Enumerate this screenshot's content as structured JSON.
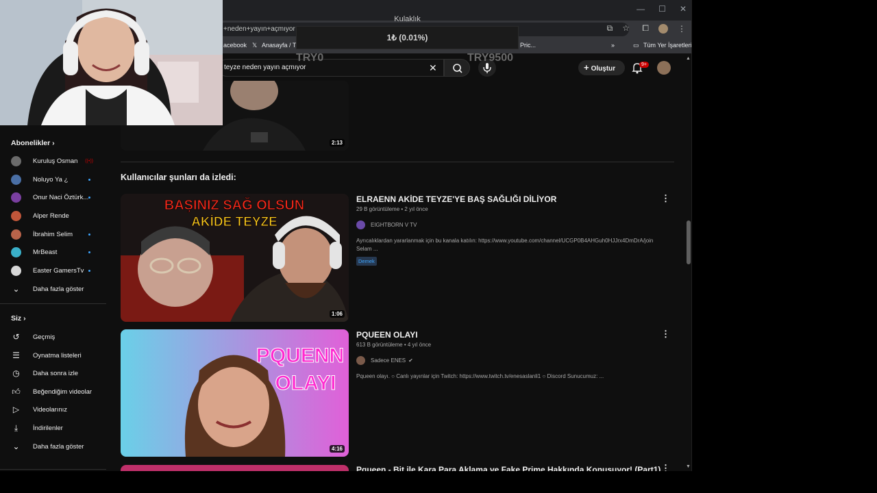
{
  "window": {
    "minimize": "—",
    "maximize": "☐",
    "close": "✕"
  },
  "address_bar": {
    "url_text": "+neden+yayın+açmıyor"
  },
  "bookmarks": {
    "items": [
      "acebook",
      "Anasayfa / Twi",
      "Pric..."
    ],
    "more": "»",
    "all_bookmarks": "Tüm Yer İşaretleri"
  },
  "overlay": {
    "title": "Kulaklık",
    "amount": "1₺ (0.01%)",
    "left_label": "TRY0",
    "right_label": "TRY9500"
  },
  "header": {
    "search_value": "teyze neden yayın açmıyor",
    "create_label": "Oluştur",
    "notification_count": "9+"
  },
  "sidebar": {
    "subscriptions_heading": "Abonelikler",
    "subscriptions": [
      {
        "name": "Kuruluş Osman",
        "color": "#6b6b6b",
        "status": "live"
      },
      {
        "name": "Noluyo Ya ¿",
        "color": "#4a6fa5",
        "status": "dot"
      },
      {
        "name": "Onur Naci Öztürk...",
        "color": "#7a3fa0",
        "status": "dot"
      },
      {
        "name": "Alper Rende",
        "color": "#c0563a",
        "status": "none"
      },
      {
        "name": "İbrahim Selim",
        "color": "#b9634a",
        "status": "dot"
      },
      {
        "name": "MrBeast",
        "color": "#3ab0c9",
        "status": "dot"
      },
      {
        "name": "Easter GamersTv",
        "color": "#d8d8d8",
        "status": "dot"
      }
    ],
    "show_more_1": "Daha fazla göster",
    "you_heading": "Siz",
    "you_items": [
      {
        "label": "Geçmiş",
        "icon": "history-icon"
      },
      {
        "label": "Oynatma listeleri",
        "icon": "playlist-icon"
      },
      {
        "label": "Daha sonra izle",
        "icon": "clock-icon"
      },
      {
        "label": "Beğendiğim videolar",
        "icon": "thumbs-up-icon"
      },
      {
        "label": "Videolarınız",
        "icon": "your-videos-icon"
      },
      {
        "label": "İndirilenler",
        "icon": "download-icon"
      }
    ],
    "show_more_2": "Daha fazla göster"
  },
  "results": {
    "top_video_duration": "2:13",
    "section_heading": "Kullanıcılar şunları da izledi:",
    "videos": [
      {
        "title": "ELRAENN AKİDE TEYZE'YE BAŞ SAĞLIĞI DİLİYOR",
        "meta": "29 B görüntüleme • 2 yıl önce",
        "channel": "EIGHTBORN V TV",
        "description_1": "Ayrıcalıklardan yararlanmak için bu kanala katılın: https://www.youtube.com/channel/UCGP0B4AHGuh0HJJrx4DmDrA/join",
        "description_2": "Selam ...",
        "badge": "Demek",
        "duration": "1:06",
        "thumb_text_1": "BAŞINIZ SAĞ OLSUN",
        "thumb_text_2": "AKİDE TEYZE"
      },
      {
        "title": "PQUEEN OLAYI",
        "meta": "613 B görüntüleme • 4 yıl önce",
        "channel": "Sadece ENES",
        "description_1": "Pqueen olayı. ○ Canlı yayınlar için Twitch: https://www.twitch.tv/enesaslanli1 ○ Discord Sunucumuz: ...",
        "duration": "4:16",
        "thumb_text_1": "PQUENN",
        "thumb_text_2": "OLAYI"
      },
      {
        "title": "Pqueen - Bit ile Kara Para Aklama ve Fake Prime Hakkında Konuşuyor! (Part1)"
      }
    ]
  },
  "colors": {
    "background": "#0f0f0f",
    "accent_red": "#cc0000",
    "link_blue": "#3ea6ff"
  }
}
